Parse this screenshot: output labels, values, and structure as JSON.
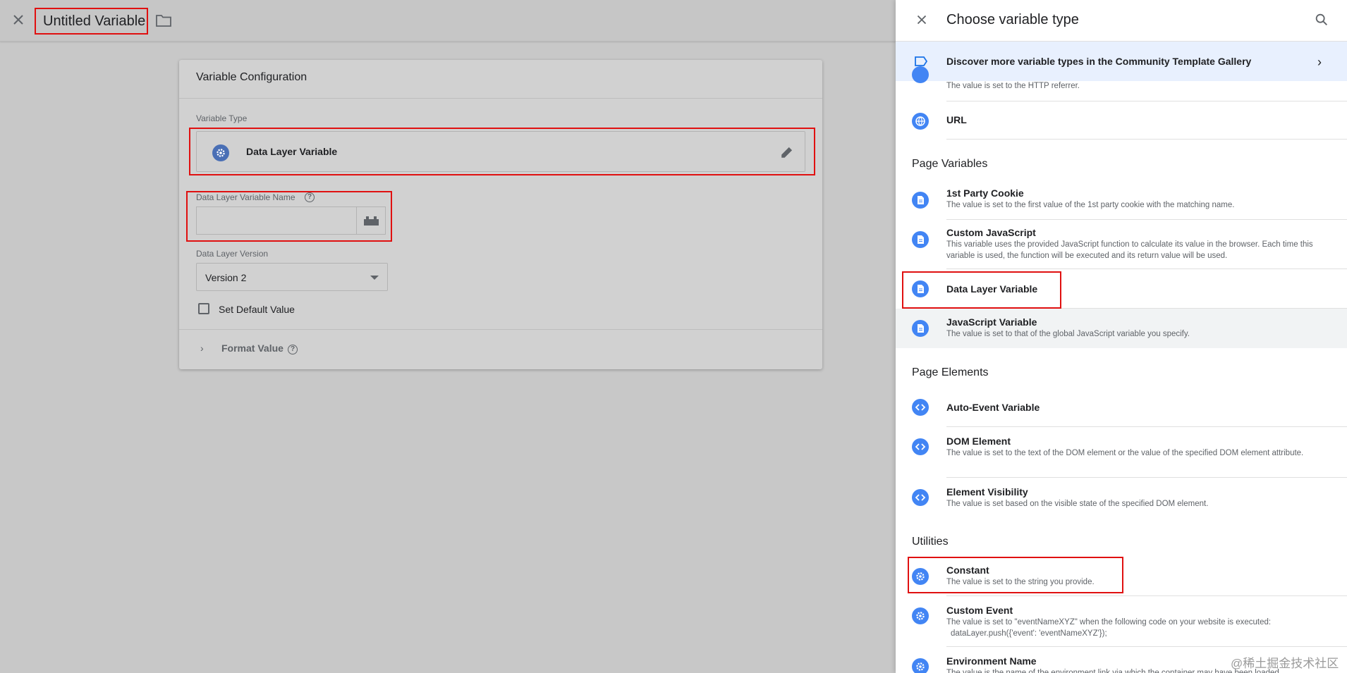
{
  "editor": {
    "title": "Untitled Variable",
    "card_title": "Variable Configuration",
    "variable_type_label": "Variable Type",
    "variable_type_value": "Data Layer Variable",
    "dl_name_label": "Data Layer Variable Name",
    "dl_name_value": "",
    "dl_version_label": "Data Layer Version",
    "dl_version_value": "Version 2",
    "set_default_label": "Set Default Value",
    "format_value_label": "Format Value"
  },
  "panel": {
    "title": "Choose variable type",
    "discover_text": "Discover more variable types in the Community Template Gallery",
    "partial_top_desc": "The value is set to the HTTP referrer.",
    "url_label": "URL",
    "sections": {
      "page_variables": "Page Variables",
      "page_elements": "Page Elements",
      "utilities": "Utilities"
    },
    "items": {
      "first_party_cookie": {
        "name": "1st Party Cookie",
        "desc": "The value is set to the first value of the 1st party cookie with the matching name."
      },
      "custom_js": {
        "name": "Custom JavaScript",
        "desc": "This variable uses the provided JavaScript function to calculate its value in the browser. Each time this variable is used, the function will be executed and its return value will be used."
      },
      "data_layer": {
        "name": "Data Layer Variable"
      },
      "js_variable": {
        "name": "JavaScript Variable",
        "desc": "The value is set to that of the global JavaScript variable you specify."
      },
      "auto_event": {
        "name": "Auto-Event Variable"
      },
      "dom_element": {
        "name": "DOM Element",
        "desc": "The value is set to the text of the DOM element or the value of the specified DOM element attribute."
      },
      "element_visibility": {
        "name": "Element Visibility",
        "desc": "The value is set based on the visible state of the specified DOM element."
      },
      "constant": {
        "name": "Constant",
        "desc": "The value is set to the string you provide."
      },
      "custom_event": {
        "name": "Custom Event",
        "desc": "The value is set to \"eventNameXYZ\" when the following code on your website is executed:",
        "code": "dataLayer.push({'event': 'eventNameXYZ'});"
      },
      "environment_name": {
        "name": "Environment Name",
        "desc": "The value is the name of the environment link via which the container may have been loaded."
      }
    }
  },
  "watermark": "@稀土掘金技术社区",
  "colors": {
    "accent": "#4285f4",
    "highlight_red": "#e01010",
    "discover_bg": "#e8f0fe",
    "overlay_gray": "#c8c8c8"
  },
  "icons": {
    "close": "close-icon",
    "folder": "folder-icon",
    "gear": "gear-icon",
    "pencil": "pencil-icon",
    "help": "help-circle-icon",
    "brick": "lego-brick-icon",
    "document": "document-icon",
    "code": "code-brackets-icon",
    "globe": "globe-icon",
    "search": "search-icon",
    "label": "label-tag-icon",
    "chevron": "chevron-right-icon"
  }
}
